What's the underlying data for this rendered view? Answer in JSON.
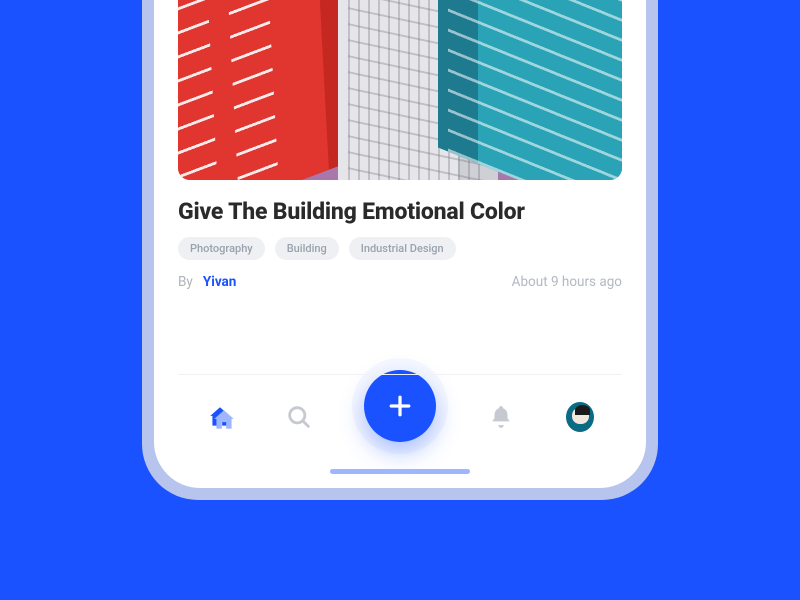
{
  "post": {
    "title": "Give The Building Emotional Color",
    "tags": [
      "Photography",
      "Building",
      "Industrial Design"
    ],
    "by_label": "By",
    "author": "Yivan",
    "time": "About 9 hours ago"
  },
  "nav": {
    "home": "home-icon",
    "search": "search-icon",
    "add": "plus-icon",
    "notifications": "bell-icon",
    "profile": "avatar"
  }
}
